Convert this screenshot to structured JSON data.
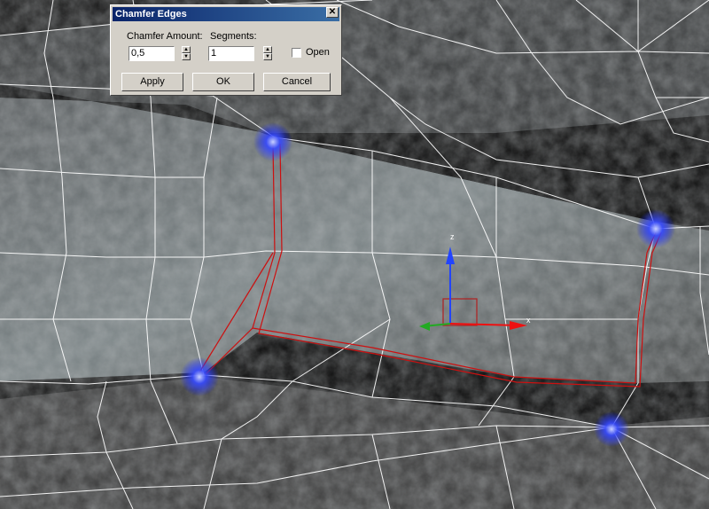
{
  "dialog": {
    "title": "Chamfer Edges",
    "chamfer_amount_label": "Chamfer Amount:",
    "chamfer_amount_value": "0,5",
    "segments_label": "Segments:",
    "segments_value": "1",
    "open_label": "Open",
    "open_checked": false,
    "apply_label": "Apply",
    "ok_label": "OK",
    "cancel_label": "Cancel"
  },
  "viewport": {
    "gizmo_z_label": "z",
    "gizmo_x_label": "x",
    "colors": {
      "wireframe": "#ffffff",
      "selected_edges": "#cc1010",
      "vertex_glow": "#2a3cff",
      "gizmo_z": "#2244ff",
      "gizmo_x": "#ee1111",
      "gizmo_y": "#22aa22"
    }
  }
}
